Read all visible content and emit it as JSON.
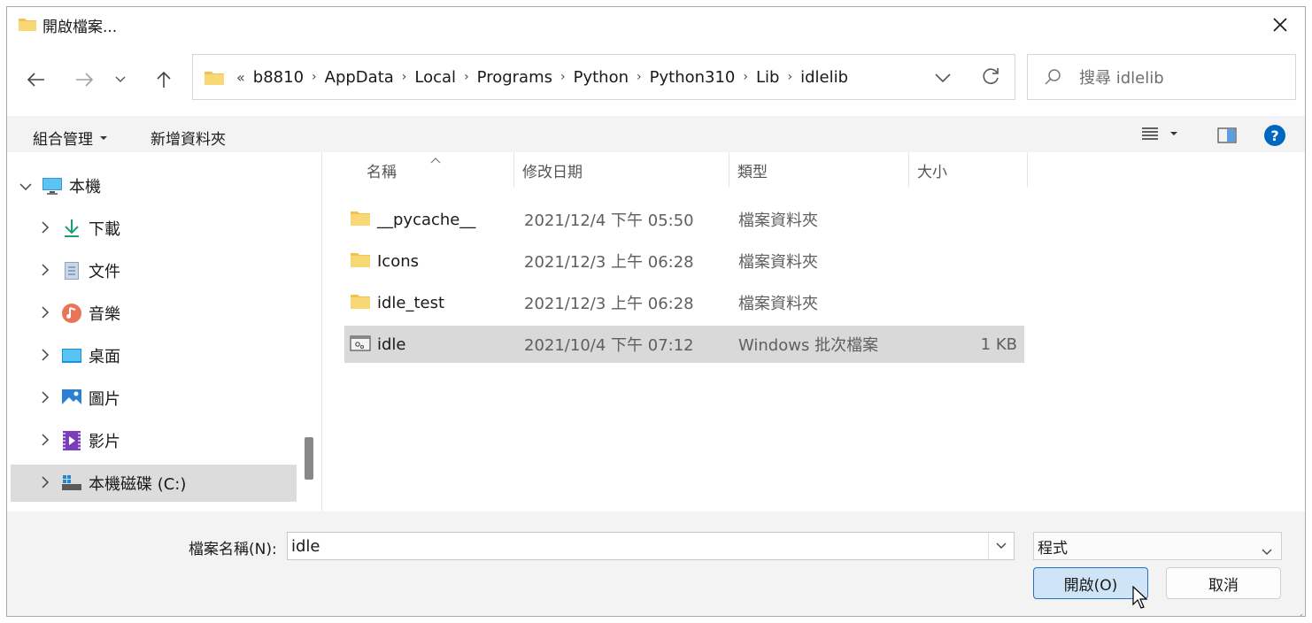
{
  "window": {
    "title": "開啟檔案..."
  },
  "address": {
    "overflow": "«",
    "crumbs": [
      "b8810",
      "AppData",
      "Local",
      "Programs",
      "Python",
      "Python310",
      "Lib",
      "idlelib"
    ]
  },
  "search": {
    "placeholder": "搜尋 idlelib"
  },
  "toolbar": {
    "organize": "組合管理",
    "new_folder": "新增資料夾"
  },
  "sidebar": {
    "root": "本機",
    "items": [
      {
        "label": "下載",
        "icon": "download-icon"
      },
      {
        "label": "文件",
        "icon": "documents-icon"
      },
      {
        "label": "音樂",
        "icon": "music-icon"
      },
      {
        "label": "桌面",
        "icon": "desktop-icon"
      },
      {
        "label": "圖片",
        "icon": "pictures-icon"
      },
      {
        "label": "影片",
        "icon": "videos-icon"
      },
      {
        "label": "本機磁碟 (C:)",
        "icon": "drive-icon"
      }
    ]
  },
  "columns": {
    "name": "名稱",
    "date": "修改日期",
    "type": "類型",
    "size": "大小"
  },
  "files": [
    {
      "name": "__pycache__",
      "date": "2021/12/4 下午 05:50",
      "type": "檔案資料夾",
      "size": "",
      "icon": "folder-icon"
    },
    {
      "name": "Icons",
      "date": "2021/12/3 上午 06:28",
      "type": "檔案資料夾",
      "size": "",
      "icon": "folder-icon"
    },
    {
      "name": "idle_test",
      "date": "2021/12/3 上午 06:28",
      "type": "檔案資料夾",
      "size": "",
      "icon": "folder-icon"
    },
    {
      "name": "idle",
      "date": "2021/10/4 下午 07:12",
      "type": "Windows 批次檔案",
      "size": "1 KB",
      "icon": "batch-file-icon",
      "selected": true
    }
  ],
  "footer": {
    "filename_label": "檔案名稱(N):",
    "filename_value": "idle",
    "filetype": "程式",
    "open_label": "開啟(O)",
    "cancel_label": "取消"
  },
  "colors": {
    "accent": "#0067c0",
    "selected_row": "#d9d9d9",
    "open_button_bg": "#cfe4f7"
  }
}
